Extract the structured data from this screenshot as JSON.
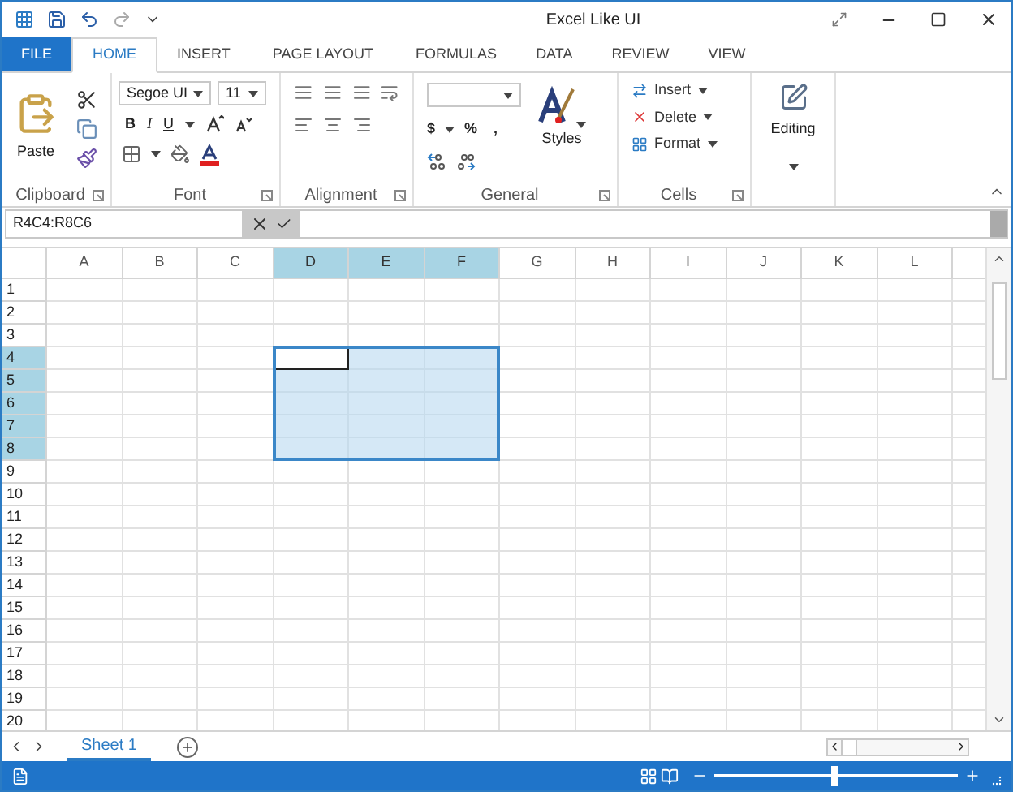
{
  "window": {
    "title": "Excel Like UI"
  },
  "ribbon_tabs": [
    {
      "label": "FILE",
      "kind": "file",
      "selected": false
    },
    {
      "label": "HOME",
      "kind": "tab",
      "selected": true
    },
    {
      "label": "INSERT",
      "kind": "tab",
      "selected": false
    },
    {
      "label": "PAGE LAYOUT",
      "kind": "tab",
      "selected": false
    },
    {
      "label": "FORMULAS",
      "kind": "tab",
      "selected": false
    },
    {
      "label": "DATA",
      "kind": "tab",
      "selected": false
    },
    {
      "label": "REVIEW",
      "kind": "tab",
      "selected": false
    },
    {
      "label": "VIEW",
      "kind": "tab",
      "selected": false
    }
  ],
  "ribbon": {
    "paste": "Paste",
    "font_name": "Segoe UI",
    "font_size": "11",
    "bold": "B",
    "italic": "I",
    "underline": "U",
    "currency": "$",
    "percent": "%",
    "comma": ",",
    "styles": "Styles",
    "cells_buttons": [
      "Insert",
      "Delete",
      "Format"
    ],
    "editing": "Editing",
    "groups": [
      "Clipboard",
      "Font",
      "Alignment",
      "General",
      "Cells"
    ]
  },
  "formula_bar": {
    "name_box": "R4C4:R8C6"
  },
  "columns": [
    {
      "label": "A",
      "selected": false,
      "active": false
    },
    {
      "label": "B",
      "selected": false,
      "active": false
    },
    {
      "label": "C",
      "selected": false,
      "active": false
    },
    {
      "label": "D",
      "selected": true,
      "active": true
    },
    {
      "label": "E",
      "selected": true,
      "active": false
    },
    {
      "label": "F",
      "selected": true,
      "active": false
    },
    {
      "label": "G",
      "selected": false,
      "active": false
    },
    {
      "label": "H",
      "selected": false,
      "active": false
    },
    {
      "label": "I",
      "selected": false,
      "active": false
    },
    {
      "label": "J",
      "selected": false,
      "active": false
    },
    {
      "label": "K",
      "selected": false,
      "active": false
    },
    {
      "label": "L",
      "selected": false,
      "active": false
    }
  ],
  "rows": [
    {
      "label": "1",
      "selected": false,
      "active": false
    },
    {
      "label": "2",
      "selected": false,
      "active": false
    },
    {
      "label": "3",
      "selected": false,
      "active": false
    },
    {
      "label": "4",
      "selected": true,
      "active": true
    },
    {
      "label": "5",
      "selected": true,
      "active": false
    },
    {
      "label": "6",
      "selected": true,
      "active": false
    },
    {
      "label": "7",
      "selected": true,
      "active": false
    },
    {
      "label": "8",
      "selected": true,
      "active": false
    },
    {
      "label": "9",
      "selected": false,
      "active": false
    },
    {
      "label": "10",
      "selected": false,
      "active": false
    },
    {
      "label": "11",
      "selected": false,
      "active": false
    },
    {
      "label": "12",
      "selected": false,
      "active": false
    },
    {
      "label": "13",
      "selected": false,
      "active": false
    },
    {
      "label": "14",
      "selected": false,
      "active": false
    },
    {
      "label": "15",
      "selected": false,
      "active": false
    },
    {
      "label": "16",
      "selected": false,
      "active": false
    },
    {
      "label": "17",
      "selected": false,
      "active": false
    },
    {
      "label": "18",
      "selected": false,
      "active": false
    },
    {
      "label": "19",
      "selected": false,
      "active": false
    },
    {
      "label": "20",
      "selected": false,
      "active": false
    }
  ],
  "sheet_tabs": [
    {
      "label": "Sheet 1",
      "selected": true
    }
  ],
  "status_bar": {
    "zoom": {
      "level": 0.49
    }
  }
}
